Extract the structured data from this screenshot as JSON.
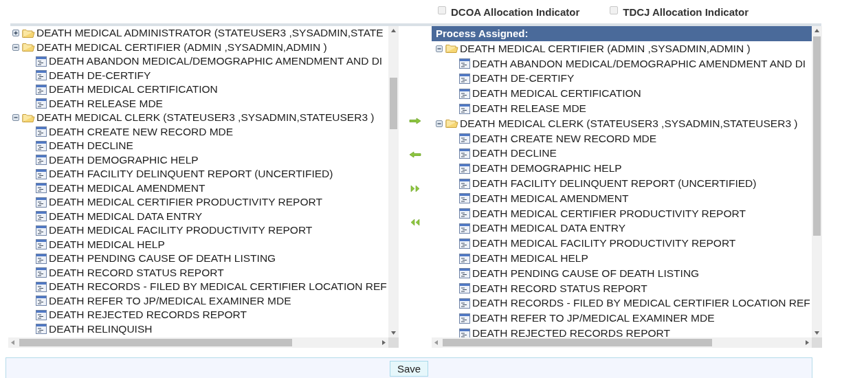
{
  "indicators": [
    {
      "label": "DCOA Allocation Indicator",
      "checked": false
    },
    {
      "label": "TDCJ Allocation Indicator",
      "checked": false
    }
  ],
  "available": {
    "groups": [
      {
        "label": "DEATH MEDICAL ADMINISTRATOR (STATEUSER3 ,SYSADMIN,STATE",
        "expanded": false
      },
      {
        "label": "DEATH MEDICAL CERTIFIER (ADMIN ,SYSADMIN,ADMIN )",
        "expanded": true,
        "children": [
          {
            "label": "DEATH ABANDON MEDICAL/DEMOGRAPHIC AMENDMENT AND DI"
          },
          {
            "label": "DEATH DE-CERTIFY"
          },
          {
            "label": "DEATH MEDICAL CERTIFICATION"
          },
          {
            "label": "DEATH RELEASE MDE"
          }
        ]
      },
      {
        "label": "DEATH MEDICAL CLERK (STATEUSER3 ,SYSADMIN,STATEUSER3 )",
        "expanded": true,
        "children": [
          {
            "label": "DEATH CREATE NEW RECORD MDE"
          },
          {
            "label": "DEATH DECLINE"
          },
          {
            "label": "DEATH DEMOGRAPHIC HELP"
          },
          {
            "label": "DEATH FACILITY DELINQUENT REPORT (UNCERTIFIED)"
          },
          {
            "label": "DEATH MEDICAL AMENDMENT"
          },
          {
            "label": "DEATH MEDICAL CERTIFIER PRODUCTIVITY REPORT"
          },
          {
            "label": "DEATH MEDICAL DATA ENTRY"
          },
          {
            "label": "DEATH MEDICAL FACILITY PRODUCTIVITY REPORT"
          },
          {
            "label": "DEATH MEDICAL HELP"
          },
          {
            "label": "DEATH PENDING CAUSE OF DEATH LISTING"
          },
          {
            "label": "DEATH RECORD STATUS REPORT"
          },
          {
            "label": "DEATH RECORDS - FILED BY MEDICAL CERTIFIER LOCATION REF"
          },
          {
            "label": "DEATH REFER TO JP/MEDICAL EXAMINER MDE"
          },
          {
            "label": "DEATH REJECTED RECORDS REPORT"
          },
          {
            "label": "DEATH RELINQUISH"
          }
        ]
      }
    ]
  },
  "assigned": {
    "title": "Process Assigned:",
    "groups": [
      {
        "label": "DEATH MEDICAL CERTIFIER (ADMIN ,SYSADMIN,ADMIN )",
        "expanded": true,
        "children": [
          {
            "label": "DEATH ABANDON MEDICAL/DEMOGRAPHIC AMENDMENT AND DI"
          },
          {
            "label": "DEATH DE-CERTIFY"
          },
          {
            "label": "DEATH MEDICAL CERTIFICATION"
          },
          {
            "label": "DEATH RELEASE MDE"
          }
        ]
      },
      {
        "label": "DEATH MEDICAL CLERK (STATEUSER3 ,SYSADMIN,STATEUSER3 )",
        "expanded": true,
        "children": [
          {
            "label": "DEATH CREATE NEW RECORD MDE"
          },
          {
            "label": "DEATH DECLINE"
          },
          {
            "label": "DEATH DEMOGRAPHIC HELP"
          },
          {
            "label": "DEATH FACILITY DELINQUENT REPORT (UNCERTIFIED)"
          },
          {
            "label": "DEATH MEDICAL AMENDMENT"
          },
          {
            "label": "DEATH MEDICAL CERTIFIER PRODUCTIVITY REPORT"
          },
          {
            "label": "DEATH MEDICAL DATA ENTRY"
          },
          {
            "label": "DEATH MEDICAL FACILITY PRODUCTIVITY REPORT"
          },
          {
            "label": "DEATH MEDICAL HELP"
          },
          {
            "label": "DEATH PENDING CAUSE OF DEATH LISTING"
          },
          {
            "label": "DEATH RECORD STATUS REPORT"
          },
          {
            "label": "DEATH RECORDS - FILED BY MEDICAL CERTIFIER LOCATION REF"
          },
          {
            "label": "DEATH REFER TO JP/MEDICAL EXAMINER MDE"
          },
          {
            "label": "DEATH REJECTED RECORDS REPORT"
          }
        ]
      }
    ]
  },
  "save_button": "Save"
}
